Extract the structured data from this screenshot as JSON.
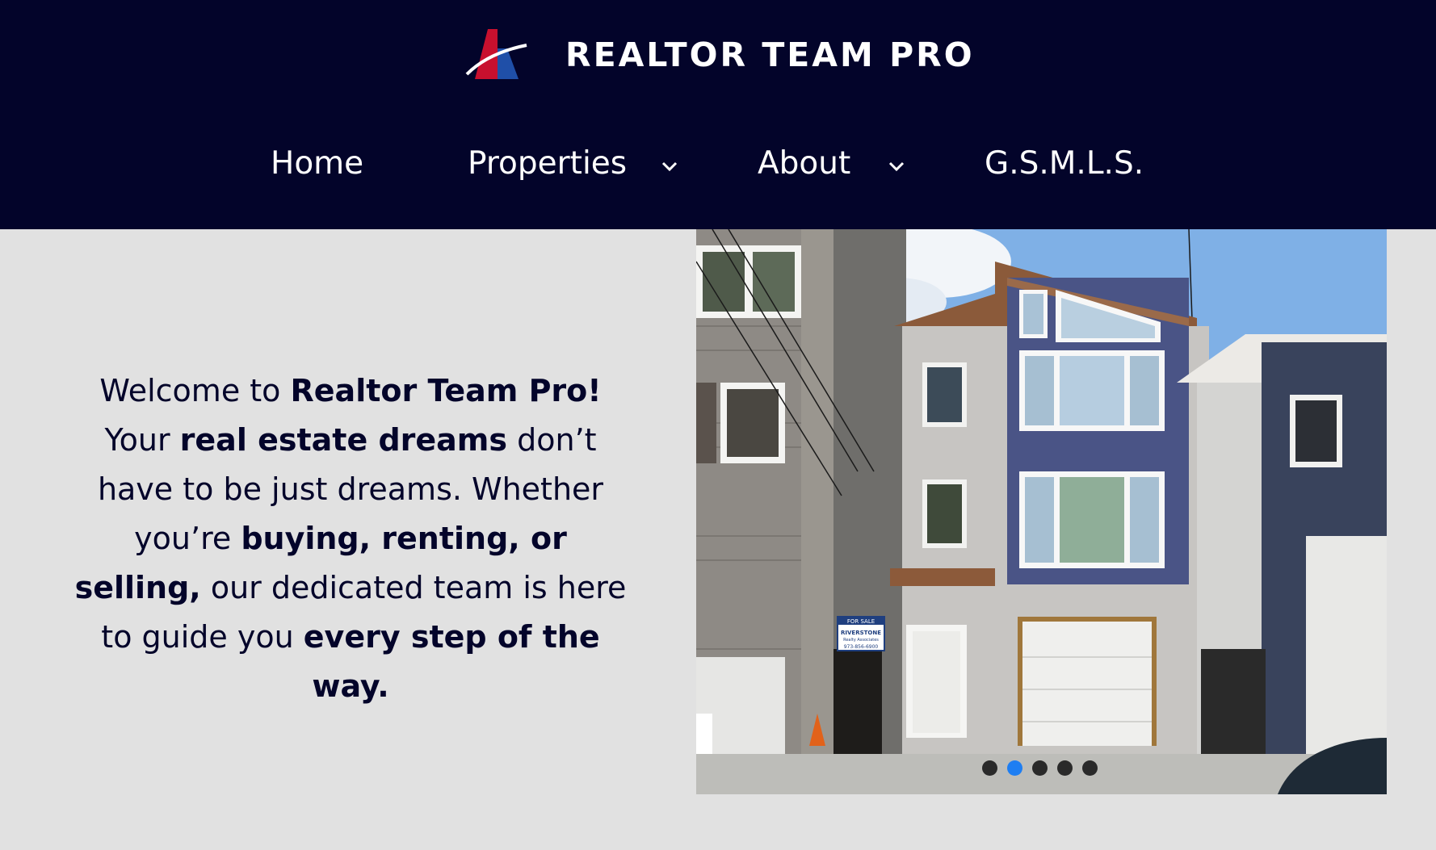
{
  "header": {
    "brand": "REALTOR TEAM PRO",
    "logo_icon": "realtor-team-pro-logo",
    "nav": [
      {
        "label": "Home",
        "has_dropdown": false
      },
      {
        "label": "Properties",
        "has_dropdown": true
      },
      {
        "label": "About",
        "has_dropdown": true
      },
      {
        "label": "G.S.M.L.S.",
        "has_dropdown": false
      }
    ]
  },
  "hero": {
    "welcome": "Welcome to ",
    "brand_bold": "Realtor Team Pro!",
    "your": " Your",
    "dreams_bold": "real estate dreams",
    "dreams_rest": " don’t have to be just dreams. Whether you’re ",
    "actions_bold": "buying, renting, or selling,",
    "guide": " our dedicated team is here to guide you ",
    "every_bold": "every step of the way."
  },
  "slider": {
    "active_slide": 2,
    "slide_count": 5,
    "sign_text": "FOR SALE",
    "sign_brand": "RIVERSTONE",
    "sign_sub": "Realty Associates",
    "sign_phone": "973-856-6900"
  },
  "colors": {
    "header_bg": "#03042a",
    "page_bg": "#e1e1e1",
    "text_dark": "#03042a",
    "dot_active": "#1e7ef2",
    "dot_inactive": "#2a2a2a"
  }
}
